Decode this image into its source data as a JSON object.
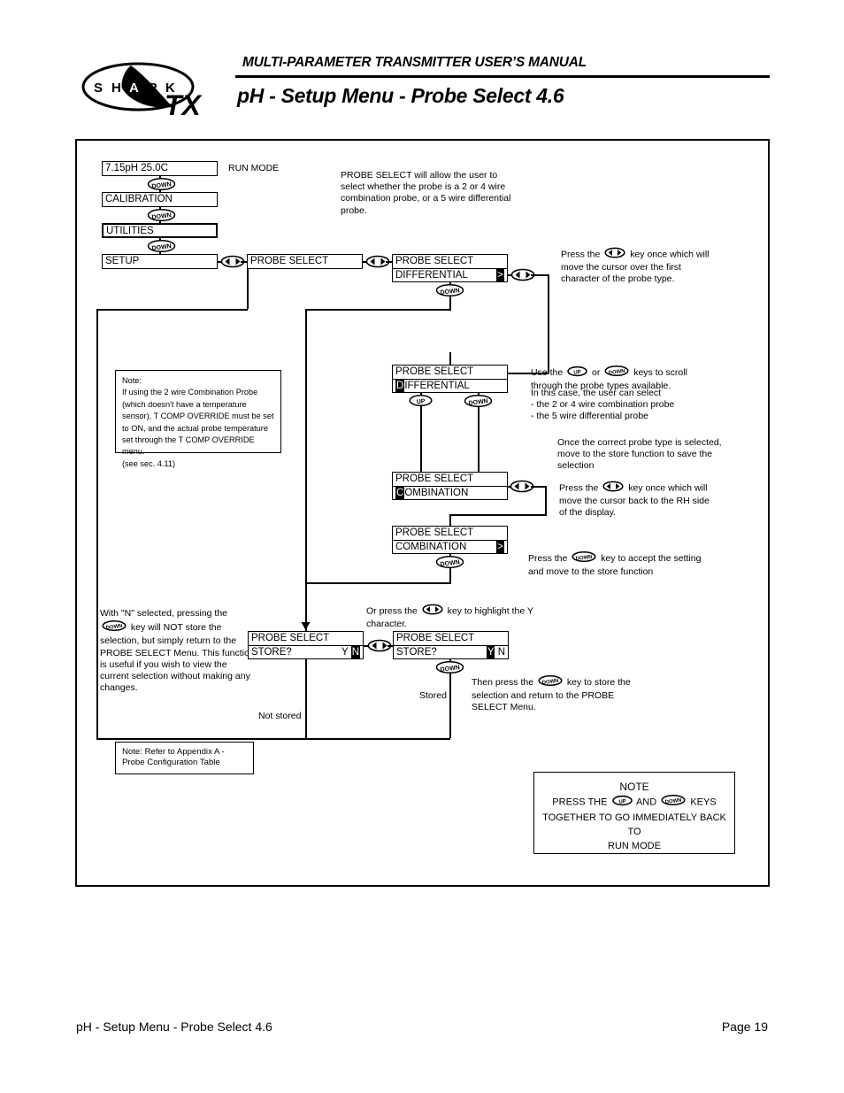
{
  "header": {
    "manual_title": "MULTI-PARAMETER TRANSMITTER USER’S MANUAL",
    "page_heading": "pH - Setup Menu - Probe Select 4.6",
    "logo_text": "S H A R K",
    "logo_sub": "TX"
  },
  "menu_chain": {
    "run_mode_label": "RUN MODE",
    "display_run": "7.15pH  25.0C",
    "display_calibration": "CALIBRATION",
    "display_utilities": "UTILITIES",
    "display_setup": "SETUP",
    "display_probe_select": "PROBE SELECT"
  },
  "screens": {
    "s1_line1": "PROBE SELECT",
    "s1_line2": "DIFFERENTIAL",
    "s1_cursor": ">",
    "s2_line1": "PROBE SELECT",
    "s2_line2_cursor": "D",
    "s2_line2_rest": "IFFERENTIAL",
    "s3_line1": "PROBE SELECT",
    "s3_line2_cursor": "C",
    "s3_line2_rest": "OMBINATION",
    "s4_line1": "PROBE SELECT",
    "s4_line2": "COMBINATION",
    "s4_cursor": ">",
    "s5_line1": "PROBE SELECT",
    "s5_line2": "STORE?",
    "s5_y": "Y",
    "s5_n": "N",
    "s6_line1": "PROBE SELECT",
    "s6_line2": "STORE?",
    "s6_y": "Y",
    "s6_n": "N"
  },
  "captions": {
    "not_stored": "Not stored",
    "stored": "Stored"
  },
  "descriptions": {
    "intro": "PROBE SELECT will allow the user to select whether the probe is a 2 or 4 wire combination probe, or a 5 wire differential probe.",
    "press_lr_first": "key once which will move the cursor over the first character of the probe type.",
    "press_lr_first_prefix": "Press the",
    "scroll_prefix": "Use the",
    "scroll_mid": "or",
    "scroll_suffix": "keys to scroll through the probe types available.",
    "scroll_line3": "In this case, the user can select",
    "scroll_line4": "- the 2 or 4 wire combination probe",
    "scroll_line5": "- the 5 wire differential probe",
    "once_correct": "Once the correct probe type is selected, move to the store function to save the selection",
    "press_lr_back_prefix": "Press the",
    "press_lr_back": "key once which will move the cursor back to the RH side of the display.",
    "press_down_accept_prefix": "Press the",
    "press_down_accept": "key to accept the setting and move to the store function",
    "with_n_prefix": "With \"N\" selected, pressing the",
    "with_n_selected": "key will NOT store the selection, but simply return to the PROBE SELECT Menu. This function is useful if you wish to view the current selection without making any changes.",
    "or_press_prefix": "Or press the",
    "or_press_lr": "key to highlight the Y character.",
    "then_press_prefix": "Then press the",
    "then_press_down": "key to store the selection and return to the PROBE SELECT Menu."
  },
  "notes": {
    "note_left_title": "Note:",
    "note_left_body": "If using the 2 wire Combination Probe (which doesn't have a temperature sensor), T COMP OVERRIDE must be set to ON, and the actual probe temperature set through the T COMP OVERRIDE menu.",
    "note_left_ref": "(see sec. 4.11)",
    "note_appendix": "Note: Refer to Appendix A - Probe Configuration Table",
    "note_bottom_title": "NOTE",
    "note_bottom_l1a": "PRESS THE",
    "note_bottom_l1b": "AND",
    "note_bottom_l1c": "KEYS",
    "note_bottom_l2": "TOGETHER TO GO IMMEDIATELY BACK TO",
    "note_bottom_l3": "RUN MODE"
  },
  "keys": {
    "down_label": "DOWN",
    "up_label": "UP"
  },
  "footer": {
    "left": "pH - Setup Menu - Probe Select 4.6",
    "right": "Page 19"
  }
}
